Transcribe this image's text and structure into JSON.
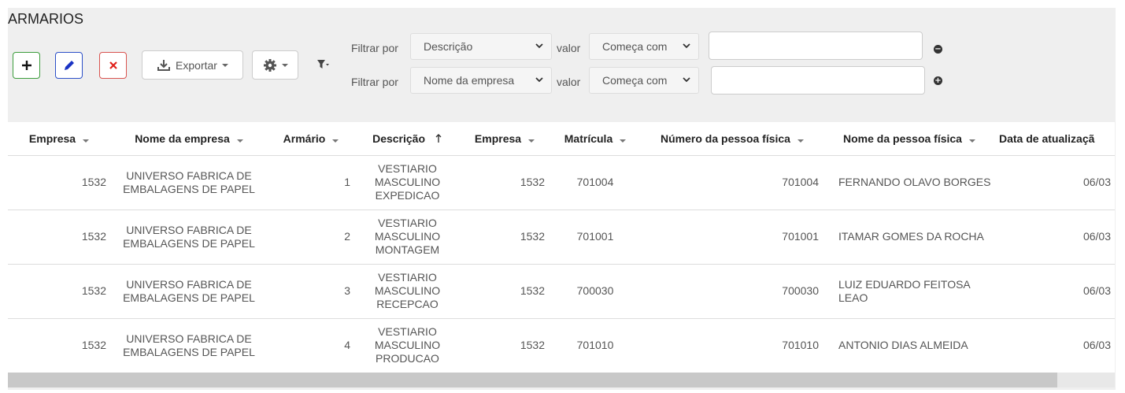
{
  "page": {
    "title": "ARMARIOS"
  },
  "toolbar": {
    "export_label": "Exportar"
  },
  "filters": [
    {
      "label": "Filtrar por",
      "field": "Descrição",
      "value_label": "valor",
      "operator": "Começa com",
      "value": "",
      "remove_icon": "minus-circle-icon"
    },
    {
      "label": "Filtrar por",
      "field": "Nome da empresa",
      "value_label": "valor",
      "operator": "Começa com",
      "value": "",
      "add_icon": "plus-circle-icon"
    }
  ],
  "table": {
    "columns": [
      "Empresa",
      "Nome da empresa",
      "Armário",
      "Descrição",
      "Empresa",
      "Matrícula",
      "Número da pessoa física",
      "Nome da pessoa física",
      "Data de atualizaçã"
    ],
    "sorted_column_icon": "sort-up-arrow-icon",
    "rows": [
      [
        "1532",
        "UNIVERSO FABRICA DE EMBALAGENS DE PAPEL",
        "1",
        "VESTIARIO MASCULINO EXPEDICAO",
        "1532",
        "701004",
        "701004",
        "FERNANDO OLAVO BORGES",
        "06/03"
      ],
      [
        "1532",
        "UNIVERSO FABRICA DE EMBALAGENS DE PAPEL",
        "2",
        "VESTIARIO MASCULINO MONTAGEM",
        "1532",
        "701001",
        "701001",
        "ITAMAR GOMES DA ROCHA",
        "06/03"
      ],
      [
        "1532",
        "UNIVERSO FABRICA DE EMBALAGENS DE PAPEL",
        "3",
        "VESTIARIO MASCULINO RECEPCAO",
        "1532",
        "700030",
        "700030",
        "LUIZ EDUARDO FEITOSA LEAO",
        "06/03"
      ],
      [
        "1532",
        "UNIVERSO FABRICA DE EMBALAGENS DE PAPEL",
        "4",
        "VESTIARIO MASCULINO PRODUCAO",
        "1532",
        "701010",
        "701010",
        "ANTONIO DIAS ALMEIDA",
        "06/03"
      ]
    ]
  },
  "colors": {
    "add": "#3c9d3c",
    "edit": "#2c50c8",
    "delete": "#d9534f"
  }
}
